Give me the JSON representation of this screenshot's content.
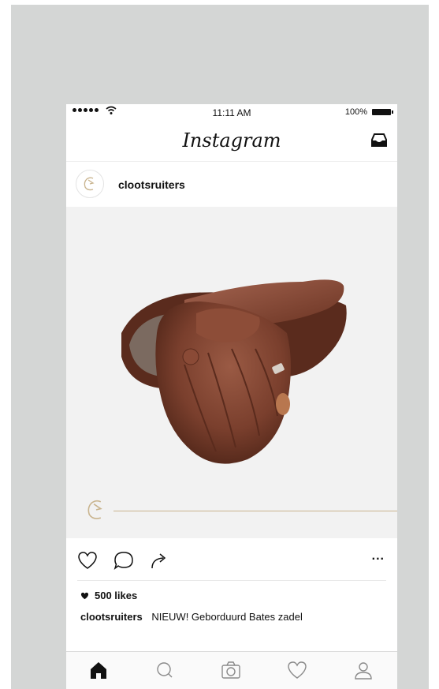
{
  "status_bar": {
    "time": "11:11 AM",
    "battery": "100%",
    "icons": [
      "signal-dots",
      "wifi-icon",
      "battery-icon"
    ]
  },
  "header": {
    "app_title": "Instagram",
    "icons": [
      "inbox-icon"
    ]
  },
  "post": {
    "username": "clootsruiters",
    "avatar_icon": "horse-logo-icon",
    "image_description_icon": "saddle-image",
    "actions": [
      "heart-icon",
      "comment-icon",
      "share-icon",
      "more-icon"
    ],
    "more_label": "...",
    "likes": "500 likes",
    "caption_user": "clootsruiters",
    "caption_text": "NIEUW! Geborduurd Bates zadel"
  },
  "tab_bar": {
    "tabs": [
      "home-icon",
      "search-icon",
      "camera-icon",
      "activity-heart-icon",
      "profile-icon"
    ]
  },
  "colors": {
    "background": "#d4d6d5",
    "accent_gold": "#c9b48e",
    "saddle_brown": "#7a3f2d"
  }
}
